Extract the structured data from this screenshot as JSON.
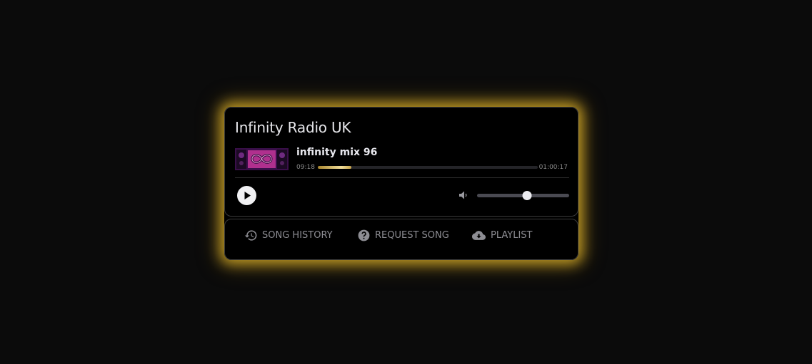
{
  "station": {
    "name": "Infinity Radio UK"
  },
  "now_playing": {
    "title": "infinity mix 96",
    "elapsed": "09:18",
    "duration": "01:00:17",
    "progress_fraction": 0.154,
    "cover_icon": "infinity-symbol-artwork"
  },
  "controls": {
    "play_icon": "play-icon",
    "volume_icon": "volume-icon",
    "volume_fraction": 0.54
  },
  "tabs": [
    {
      "label": "SONG HISTORY",
      "icon": "history-icon"
    },
    {
      "label": "REQUEST SONG",
      "icon": "question-circle-icon"
    },
    {
      "label": "PLAYLIST",
      "icon": "cloud-download-icon"
    }
  ],
  "colors": {
    "background": "#0b0b0b",
    "glow": "#d4aa28",
    "progress_gold": "#f2df9c",
    "text_muted": "#8d8d93"
  }
}
